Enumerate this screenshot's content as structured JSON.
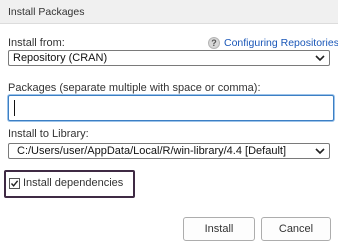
{
  "window": {
    "title": "Install Packages"
  },
  "install_from": {
    "label": "Install from:",
    "help_glyph": "?",
    "help_link": "Configuring Repositories",
    "selected": "Repository (CRAN)"
  },
  "packages": {
    "label": "Packages (separate multiple with space or comma):",
    "value": ""
  },
  "library": {
    "label": "Install to Library:",
    "selected": "C:/Users/user/AppData/Local/R/win-library/4.4 [Default]"
  },
  "dependencies": {
    "label": "Install dependencies",
    "checked": true
  },
  "buttons": {
    "install": "Install",
    "cancel": "Cancel"
  },
  "colors": {
    "link": "#1a57b8",
    "focus_border": "#3c7fc4",
    "highlight_border": "#3f2a44"
  },
  "icons": {
    "help": "help-icon",
    "dropdown": "chevron-down-icon",
    "check": "check-icon"
  }
}
